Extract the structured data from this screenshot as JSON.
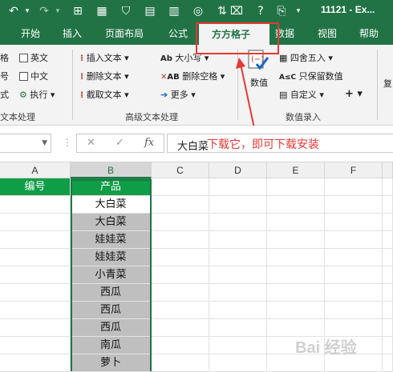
{
  "title_bar": {
    "doc_title": "11121 - Ex..."
  },
  "tabs": [
    "开始",
    "插入",
    "页面布局",
    "公式",
    "方方格子",
    "数据",
    "视图",
    "帮助"
  ],
  "active_tab": "方方格子",
  "ribbon": {
    "left_items": [
      "格",
      "号",
      "式"
    ],
    "checkbox_english": "英文",
    "checkbox_chinese": "中文",
    "execute": "执行",
    "insert_text": "插入文本",
    "delete_text": "删除文本",
    "cut_text": "截取文本",
    "case": "大小写",
    "delete_space": "删除空格",
    "more": "更多",
    "value_btn": "数值",
    "round": "四舍五入",
    "keep_values": "只保留数值",
    "custom": "自定义",
    "plus": "+",
    "right_partial": "复",
    "group_text_processing_left": "文本处理",
    "group_advanced_text": "高级文本处理",
    "group_value_entry": "数值录入"
  },
  "formula_bar": {
    "value": "大白菜",
    "fx": "fx"
  },
  "annotation": "下载它，即可下载安装",
  "columns": [
    "A",
    "B",
    "C",
    "D",
    "E",
    "F"
  ],
  "header_row": {
    "A": "编号",
    "B": "产品"
  },
  "products": [
    "大白菜",
    "大白菜",
    "娃娃菜",
    "娃娃菜",
    "小青菜",
    "西瓜",
    "西瓜",
    "西瓜",
    "南瓜",
    "萝卜"
  ],
  "watermark": "Bai 经验",
  "colors": {
    "excel_green": "#217346",
    "header_green": "#0f9d48",
    "highlight_red": "#e53935",
    "selected_gray": "#bfbfbf"
  }
}
